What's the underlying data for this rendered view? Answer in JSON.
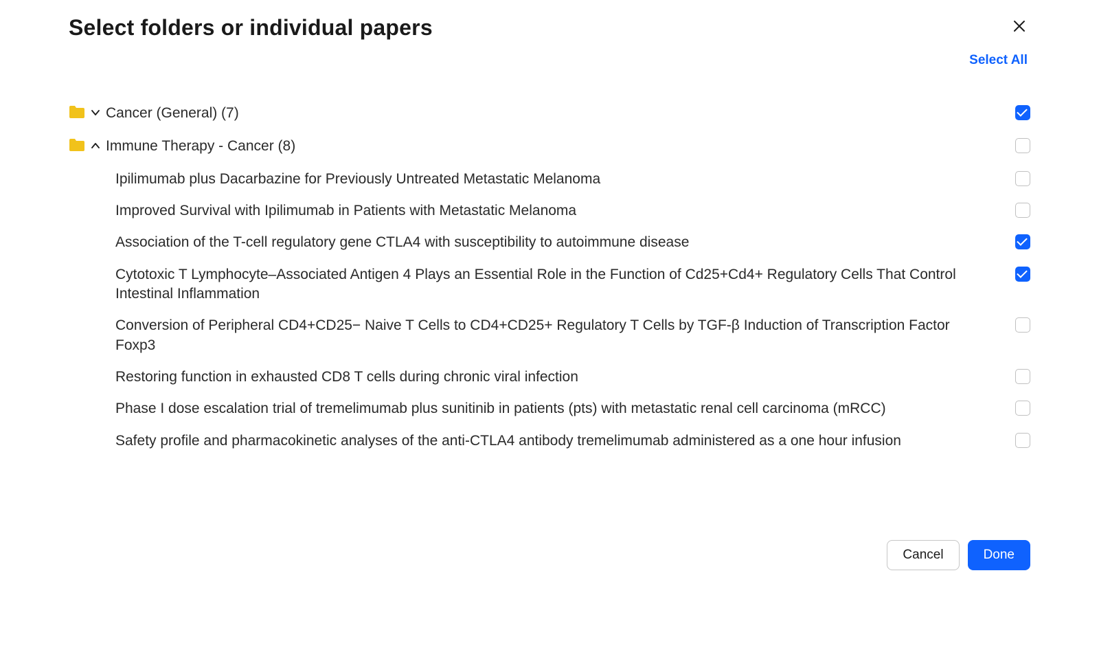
{
  "header": {
    "title": "Select folders or individual papers",
    "select_all_label": "Select All"
  },
  "folders": [
    {
      "name": "Cancer (General)",
      "count": 7,
      "expanded": false,
      "checked": true,
      "papers": []
    },
    {
      "name": "Immune Therapy - Cancer",
      "count": 8,
      "expanded": true,
      "checked": false,
      "papers": [
        {
          "title": "Ipilimumab plus Dacarbazine for Previously Untreated Metastatic Melanoma",
          "checked": false
        },
        {
          "title": "Improved Survival with Ipilimumab in Patients with Metastatic Melanoma",
          "checked": false
        },
        {
          "title": "Association of the T-cell regulatory gene CTLA4 with susceptibility to autoimmune disease",
          "checked": true
        },
        {
          "title": "Cytotoxic T Lymphocyte–Associated Antigen 4 Plays an Essential Role in the Function of Cd25+Cd4+ Regulatory Cells That Control Intestinal Inflammation",
          "checked": true
        },
        {
          "title": "Conversion of Peripheral CD4+CD25− Naive T Cells to CD4+CD25+ Regulatory T Cells by TGF-β Induction of Transcription Factor Foxp3",
          "checked": false
        },
        {
          "title": "Restoring function in exhausted CD8 T cells during chronic viral infection",
          "checked": false
        },
        {
          "title": "Phase I dose escalation trial of tremelimumab plus sunitinib in patients (pts) with metastatic renal cell carcinoma (mRCC)",
          "checked": false
        },
        {
          "title": "Safety profile and pharmacokinetic analyses of the anti-CTLA4 antibody tremelimumab administered as a one hour infusion",
          "checked": false
        }
      ]
    }
  ],
  "footer": {
    "cancel_label": "Cancel",
    "done_label": "Done"
  },
  "colors": {
    "accent": "#0f62fe",
    "folder": "#f1c21b"
  }
}
